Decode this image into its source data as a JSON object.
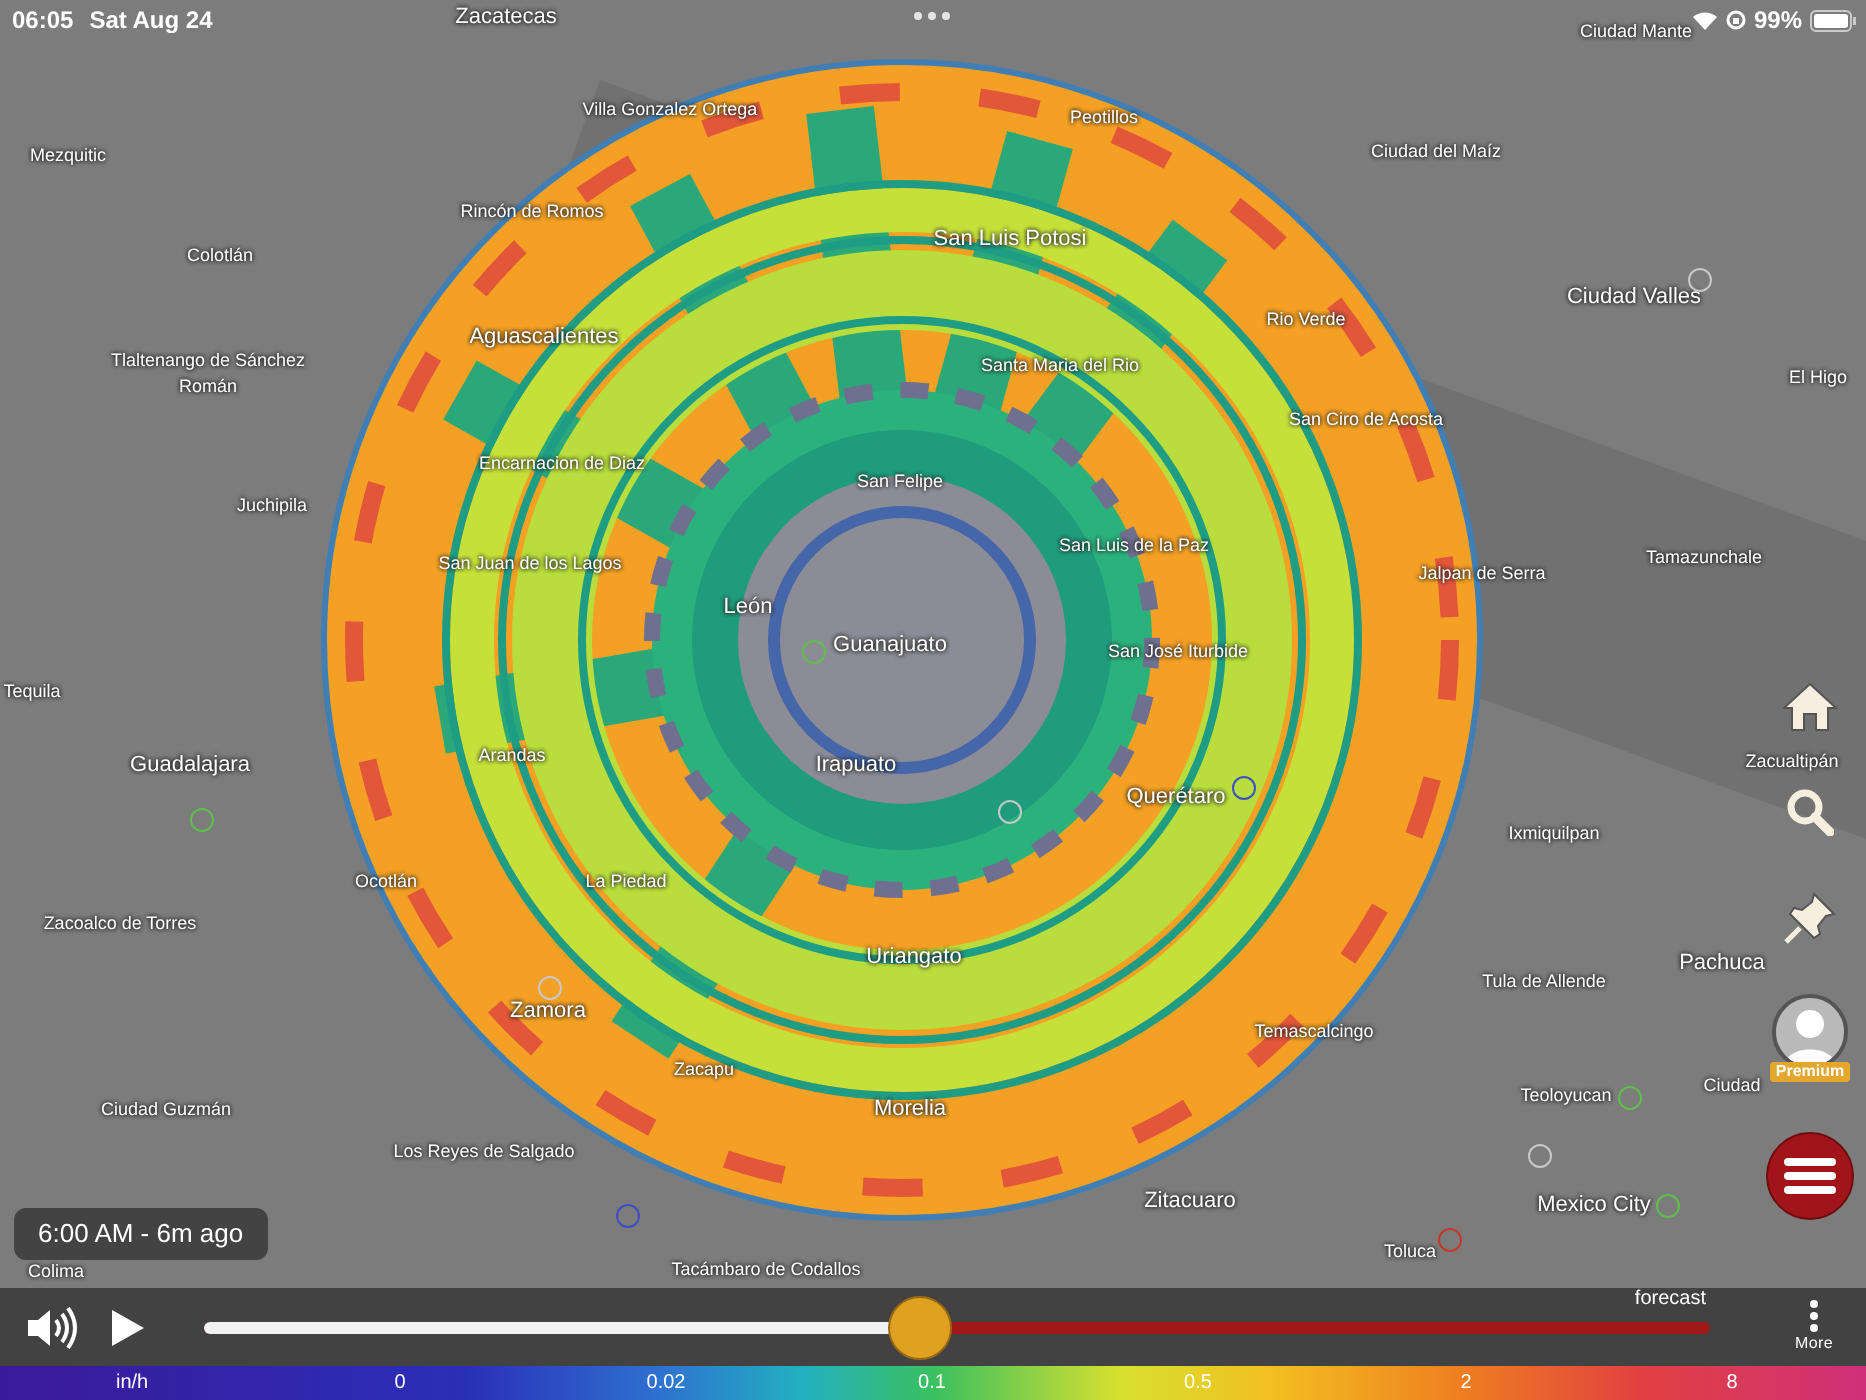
{
  "status_bar": {
    "time": "06:05",
    "date": "Sat Aug 24",
    "battery": "99%"
  },
  "map_labels": [
    "Zacatecas",
    "Ciudad Mante",
    "Villa Gonzalez Ortega",
    "Peotillos",
    "Mezquitic",
    "Ciudad del Maíz",
    "Rincón de Romos",
    "Colotlán",
    "San Luis Potosi",
    "Ciudad Valles",
    "Rio Verde",
    "Aguascalientes",
    "Tlaltenango de Sánchez Román",
    "Santa Maria del Rio",
    "El Higo",
    "San Ciro de Acosta",
    "Encarnacion de Diaz",
    "San Felipe",
    "Juchipila",
    "San Luis de la Paz",
    "Tamazunchale",
    "Jalpan de Serra",
    "San Juan de los Lagos",
    "León",
    "Guanajuato",
    "San José Iturbide",
    "Tequila",
    "Arandas",
    "Guadalajara",
    "Irapuato",
    "Querétaro",
    "Zacualtipán",
    "Ixmiquilpan",
    "Ocotlán",
    "La Piedad",
    "Zacoalco de Torres",
    "Pachuca",
    "Uriangato",
    "Tula de Allende",
    "Zamora",
    "Temascalcingo",
    "Zacapu",
    "Ciudad",
    "Teoloyucan",
    "Morelia",
    "Ciudad Guzmán",
    "Los Reyes de Salgado",
    "Zitacuaro",
    "Mexico City",
    "Toluca",
    "Colima",
    "Tacámbaro de Codallos"
  ],
  "station_markers": [
    {
      "color": "#5fbf4a"
    },
    {
      "color": "#5fbf4a"
    },
    {
      "color": "#c8c8c8"
    },
    {
      "color": "#c8c8c8"
    },
    {
      "color": "#c8c8c8"
    },
    {
      "color": "#c8c8c8"
    },
    {
      "color": "#3b4fc4"
    },
    {
      "color": "#3b4fc4"
    },
    {
      "color": "#5fbf4a"
    },
    {
      "color": "#5fbf4a"
    },
    {
      "color": "#c0392b"
    }
  ],
  "time_badge": "6:00 AM - 6m ago",
  "side_buttons": {
    "premium_badge": "Premium"
  },
  "timeline": {
    "level": 0.475,
    "forecast_label": "forecast",
    "more_label": "More"
  },
  "legend": {
    "unit": "in/h",
    "ticks": [
      "0",
      "0.02",
      "0.1",
      "0.5",
      "2",
      "8"
    ]
  }
}
